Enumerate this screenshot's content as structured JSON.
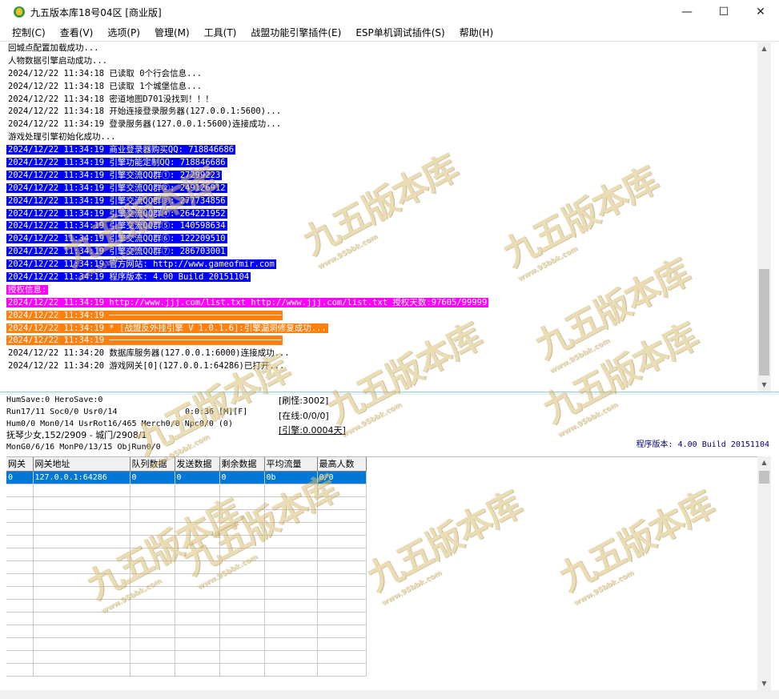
{
  "window": {
    "title": "九五版本库18号04区 [商业版]",
    "minimize": "—",
    "maximize": "☐",
    "close": "✕"
  },
  "menu": [
    "控制(C)",
    "查看(V)",
    "选项(P)",
    "管理(M)",
    "工具(T)",
    "战盟功能引擎插件(E)",
    "ESP单机调试插件(S)",
    "帮助(H)"
  ],
  "log": [
    {
      "text": "回城点配置加载成功...",
      "hl": ""
    },
    {
      "text": "人物数据引擎启动成功...",
      "hl": ""
    },
    {
      "text": "2024/12/22 11:34:18 已读取 0个行会信息...",
      "hl": ""
    },
    {
      "text": "2024/12/22 11:34:18 已读取 1个城堡信息...",
      "hl": ""
    },
    {
      "text": "2024/12/22 11:34:18 密道地图D701没找到！！！",
      "hl": ""
    },
    {
      "text": "2024/12/22 11:34:18 开始连接登录服务器(127.0.0.1:5600)...",
      "hl": ""
    },
    {
      "text": "2024/12/22 11:34:19 登录服务器(127.0.0.1:5600)连接成功...",
      "hl": ""
    },
    {
      "text": "游戏处理引擎初始化成功...",
      "hl": ""
    },
    {
      "text": "2024/12/22 11:34:19 商业登录器购买QQ: 718846686",
      "hl": "blue"
    },
    {
      "text": "2024/12/22 11:34:19 引擎功能定制QQ: 718846686",
      "hl": "blue"
    },
    {
      "text": "2024/12/22 11:34:19 引擎交流QQ群①: 27299223",
      "hl": "blue"
    },
    {
      "text": "2024/12/22 11:34:19 引擎交流QQ群②: 249126912",
      "hl": "blue"
    },
    {
      "text": "2024/12/22 11:34:19 引擎交流QQ群③: 277734856",
      "hl": "blue"
    },
    {
      "text": "2024/12/22 11:34:19 引擎交流QQ群④: 264221952",
      "hl": "blue"
    },
    {
      "text": "2024/12/22 11:34:19 引擎交流QQ群⑤: 140598634",
      "hl": "blue"
    },
    {
      "text": "2024/12/22 11:34:19 引擎交流QQ群⑥: 122209510",
      "hl": "blue"
    },
    {
      "text": "2024/12/22 11:34:19 引擎交流QQ群⑦: 286703001",
      "hl": "blue"
    },
    {
      "text": "2024/12/22 11:34:19 官方网站: http://www.gameofmir.com",
      "hl": "blue"
    },
    {
      "text": "2024/12/22 11:34:19 程序版本: 4.00 Build 20151104",
      "hl": "blue"
    },
    {
      "text": "授权信息:",
      "hl": "magenta"
    },
    {
      "text": "2024/12/22 11:34:19 http://www.jjj.com/list.txt http://www.jjj.com/list.txt 授权天数:97605/99999",
      "hl": "magenta"
    },
    {
      "text": "2024/12/22 11:34:19 ──────────────────────────────────",
      "hl": "orange"
    },
    {
      "text": "2024/12/22 11:34:19 * [战盟反外挂引擎 V 1.0.1.6]:引擎漏洞修复成功...",
      "hl": "orange"
    },
    {
      "text": "2024/12/22 11:34:19 ──────────────────────────────────",
      "hl": "orange"
    },
    {
      "text": "2024/12/22 11:34:20 数据库服务器(127.0.0.1:6000)连接成功...",
      "hl": ""
    },
    {
      "text": "2024/12/22 11:34:20 游戏网关[0](127.0.0.1:64286)已打开...",
      "hl": ""
    }
  ],
  "status": {
    "line1": "HumSave:0 HeroSave:0",
    "line2": "Run17/11 Soc0/0 Usr0/14",
    "time": "0:0:36 [M][F]",
    "line3": "Hum0/0 Mon0/14 UsrRot16/465 Merch0/0 Npc0/0 (0)",
    "line4": "抚琴少女,152/2909 - 城门/2908/1",
    "line5": "MonG0/6/16 MonP0/13/15 ObjRun0/0",
    "refresh": "[刷怪:3002]",
    "online": "[在线:0/0/0]",
    "engine": "[引擎:0.0004天]",
    "version": "程序版本: 4.00 Build 20151104"
  },
  "grid": {
    "headers": [
      "网关",
      "网关地址",
      "队列数据",
      "发送数据",
      "剩余数据",
      "平均流量",
      "最高人数"
    ],
    "rows": [
      [
        "0",
        "127.0.0.1:64286",
        "0",
        "0",
        "0",
        "0b",
        "0/0"
      ]
    ]
  },
  "watermark": {
    "text": "九五版本库",
    "sub": "www.95bbk.com"
  }
}
